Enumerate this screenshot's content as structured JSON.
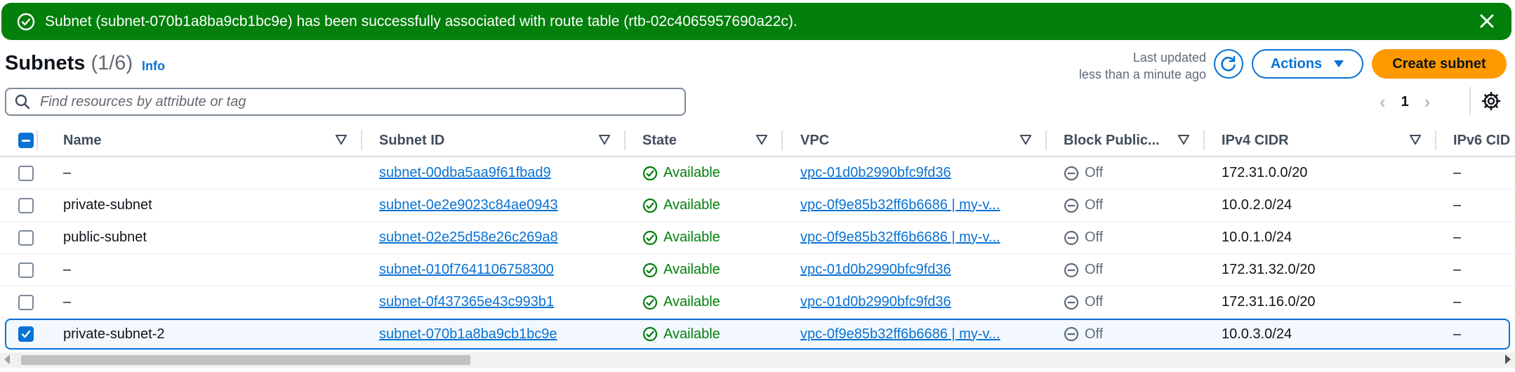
{
  "flash": {
    "message": "Subnet (subnet-070b1a8ba9cb1bc9e) has been successfully associated with route table (rtb-02c4065957690a22c).",
    "color": "#037f0c"
  },
  "header": {
    "title": "Subnets",
    "count": "(1/6)",
    "info": "Info",
    "last_updated_line1": "Last updated",
    "last_updated_line2": "less than a minute ago",
    "actions_label": "Actions",
    "create_label": "Create subnet"
  },
  "filter": {
    "placeholder": "Find resources by attribute or tag"
  },
  "pagination": {
    "current_page": "1"
  },
  "table": {
    "columns": [
      "Name",
      "Subnet ID",
      "State",
      "VPC",
      "Block Public...",
      "IPv4 CIDR",
      "IPv6 CID"
    ],
    "rows": [
      {
        "name": "–",
        "subnet_id": "subnet-00dba5aa9f61fbad9",
        "state": "Available",
        "vpc": "vpc-01d0b2990bfc9fd36",
        "block_public": "Off",
        "ipv4": "172.31.0.0/20",
        "ipv6": "–",
        "selected": false
      },
      {
        "name": "private-subnet",
        "subnet_id": "subnet-0e2e9023c84ae0943",
        "state": "Available",
        "vpc": "vpc-0f9e85b32ff6b6686 | my-v...",
        "block_public": "Off",
        "ipv4": "10.0.2.0/24",
        "ipv6": "–",
        "selected": false
      },
      {
        "name": "public-subnet",
        "subnet_id": "subnet-02e25d58e26c269a8",
        "state": "Available",
        "vpc": "vpc-0f9e85b32ff6b6686 | my-v...",
        "block_public": "Off",
        "ipv4": "10.0.1.0/24",
        "ipv6": "–",
        "selected": false
      },
      {
        "name": "–",
        "subnet_id": "subnet-010f7641106758300",
        "state": "Available",
        "vpc": "vpc-01d0b2990bfc9fd36",
        "block_public": "Off",
        "ipv4": "172.31.32.0/20",
        "ipv6": "–",
        "selected": false
      },
      {
        "name": "–",
        "subnet_id": "subnet-0f437365e43c993b1",
        "state": "Available",
        "vpc": "vpc-01d0b2990bfc9fd36",
        "block_public": "Off",
        "ipv4": "172.31.16.0/20",
        "ipv6": "–",
        "selected": false
      },
      {
        "name": "private-subnet-2",
        "subnet_id": "subnet-070b1a8ba9cb1bc9e",
        "state": "Available",
        "vpc": "vpc-0f9e85b32ff6b6686 | my-v...",
        "block_public": "Off",
        "ipv4": "10.0.3.0/24",
        "ipv6": "–",
        "selected": true
      }
    ]
  },
  "colors": {
    "accent": "#0972d3",
    "primary_button": "#ff9900",
    "success": "#037f0c"
  }
}
